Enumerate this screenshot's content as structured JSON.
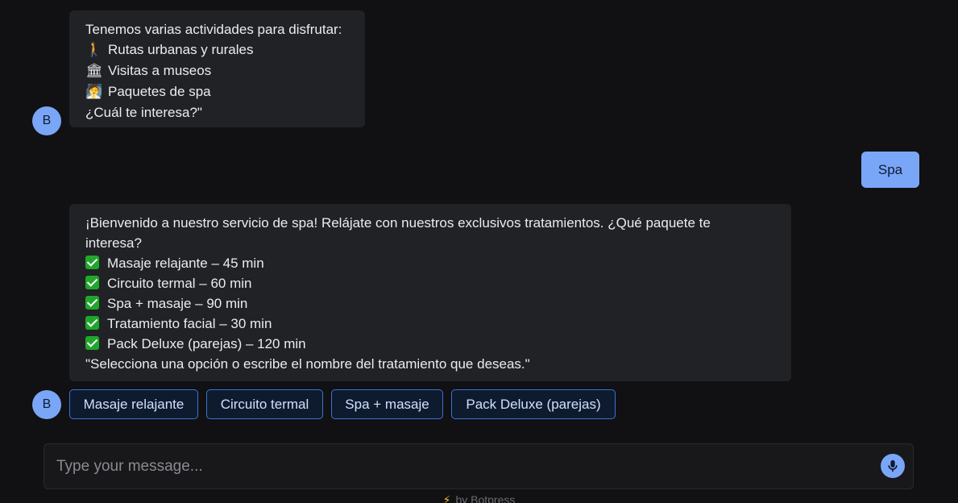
{
  "bot_avatar_letter": "B",
  "messages": {
    "bot_1": {
      "lines": [
        {
          "text": "Tenemos varias actividades para disfrutar:"
        },
        {
          "emoji": "🚶",
          "text": "Rutas urbanas y rurales"
        },
        {
          "emoji": "🏛",
          "text": "Visitas a museos"
        },
        {
          "emoji": "🧖",
          "text": "Paquetes de spa"
        },
        {
          "text": "¿Cuál te interesa?\""
        }
      ]
    },
    "user_1": {
      "text": "Spa"
    },
    "bot_2": {
      "intro_1": "¡Bienvenido a nuestro servicio de spa! Relájate con nuestros exclusivos tratamientos. ¿Qué paquete te",
      "intro_2": "interesa?",
      "options": [
        "Masaje relajante – 45 min",
        "Circuito termal – 60 min",
        "Spa + masaje – 90 min",
        "Tratamiento facial – 30 min",
        "Pack Deluxe (parejas) – 120 min"
      ],
      "outro": "\"Selecciona una opción o escribe el nombre del tratamiento que deseas.\""
    }
  },
  "quick_replies": [
    "Masaje relajante",
    "Circuito termal",
    "Spa + masaje",
    "Pack Deluxe (parejas)"
  ],
  "composer": {
    "placeholder": "Type your message...",
    "mic_icon": "microphone-icon"
  },
  "footer": {
    "bolt_icon": "⚡",
    "text": "by Botpress"
  },
  "colors": {
    "background": "#111113",
    "bubble_bot": "#212226",
    "accent": "#7aa6f7",
    "chip_border": "#3b72d9",
    "check_green": "#1fa72b"
  }
}
